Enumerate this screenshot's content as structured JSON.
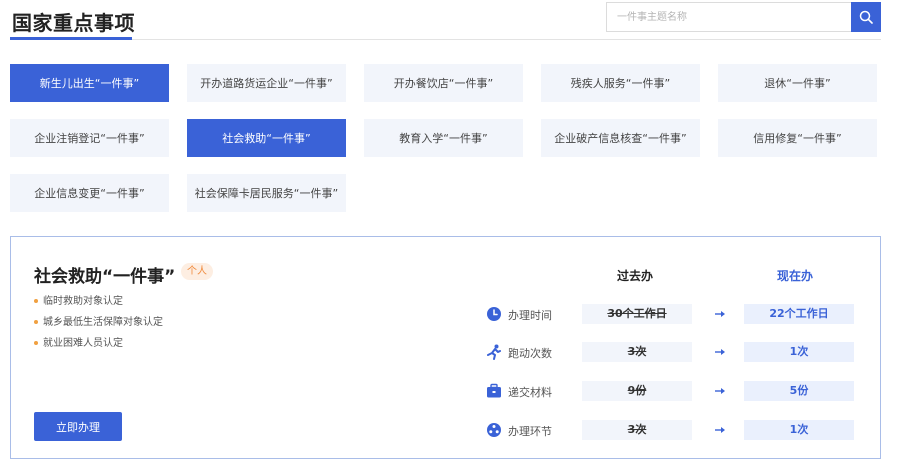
{
  "header": {
    "title": "国家重点事项",
    "search_placeholder": "一件事主题名称"
  },
  "tiles": [
    {
      "label": "新生儿出生“一件事”",
      "active": true
    },
    {
      "label": "开办道路货运企业“一件事”",
      "active": false
    },
    {
      "label": "开办餐饮店“一件事”",
      "active": false
    },
    {
      "label": "残疾人服务“一件事”",
      "active": false
    },
    {
      "label": "退休“一件事”",
      "active": false
    },
    {
      "label": "企业注销登记“一件事”",
      "active": false
    },
    {
      "label": "社会救助“一件事”",
      "active": true
    },
    {
      "label": "教育入学“一件事”",
      "active": false
    },
    {
      "label": "企业破产信息核查“一件事”",
      "active": false
    },
    {
      "label": "信用修复“一件事”",
      "active": false
    },
    {
      "label": "企业信息变更“一件事”",
      "active": false
    },
    {
      "label": "社会保障卡居民服务“一件事”",
      "active": false
    }
  ],
  "detail": {
    "title": "社会救助“一件事”",
    "tag": "个人",
    "items": [
      "临时救助对象认定",
      "城乡最低生活保障对象认定",
      "就业困难人员认定"
    ],
    "apply_label": "立即办理",
    "col_past": "过去办",
    "col_now": "现在办",
    "metrics": [
      {
        "icon": "clock-icon",
        "label": "办理时间",
        "past": "30个工作日",
        "now": "22个工作日"
      },
      {
        "icon": "running-icon",
        "label": "跑动次数",
        "past": "3次",
        "now": "1次"
      },
      {
        "icon": "briefcase-icon",
        "label": "递交材料",
        "past": "9份",
        "now": "5份"
      },
      {
        "icon": "steps-icon",
        "label": "办理环节",
        "past": "3次",
        "now": "1次"
      }
    ]
  },
  "colors": {
    "accent": "#3a62d7",
    "tag": "#f08a3c",
    "tile_bg": "#f2f5fb",
    "bullet": "#f0a040"
  }
}
